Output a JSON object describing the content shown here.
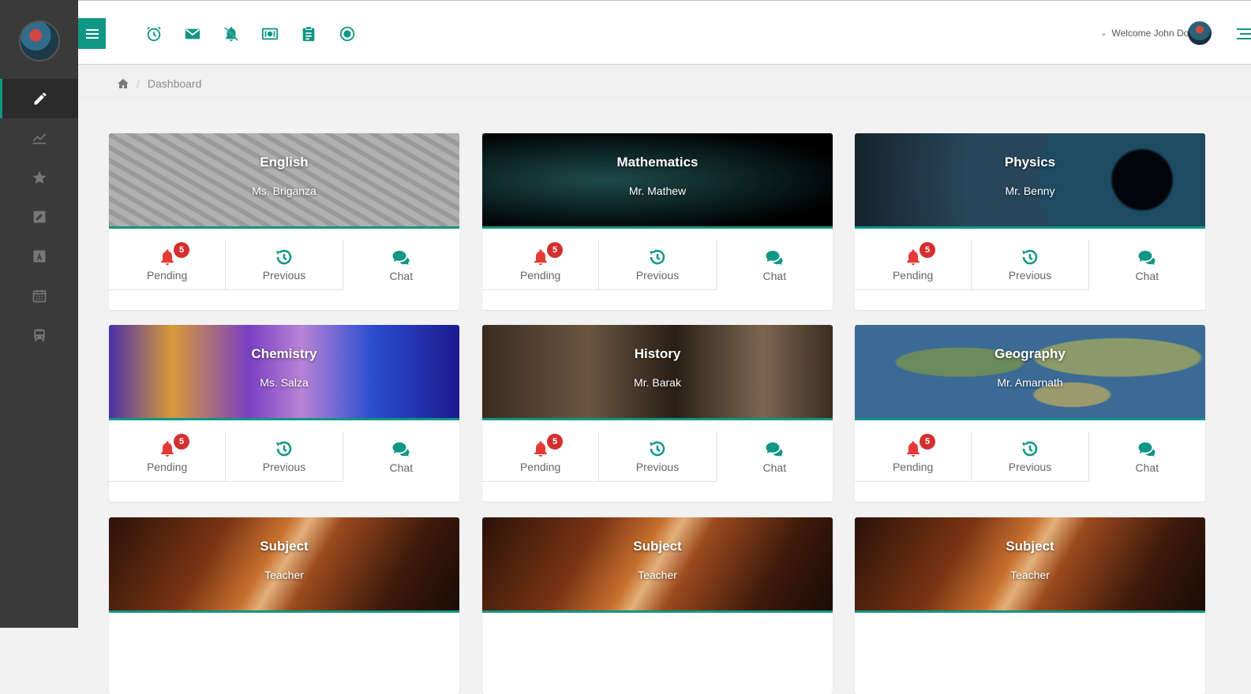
{
  "header": {
    "welcome_text": "Welcome John Doe"
  },
  "breadcrumb": {
    "home_icon": "home-icon",
    "current": "Dashboard"
  },
  "sidebar": {
    "items": [
      {
        "icon": "pencil-icon",
        "active": true
      },
      {
        "icon": "chart-line-icon",
        "active": false
      },
      {
        "icon": "star-icon",
        "active": false
      },
      {
        "icon": "edit-icon",
        "active": false
      },
      {
        "icon": "font-icon",
        "active": false
      },
      {
        "icon": "calendar-icon",
        "active": false
      },
      {
        "icon": "bus-icon",
        "active": false
      }
    ]
  },
  "topbar_icons": [
    "alarm-clock-icon",
    "envelope-icon",
    "bell-off-icon",
    "money-icon",
    "clipboard-icon",
    "record-icon"
  ],
  "actions": {
    "pending": "Pending",
    "previous": "Previous",
    "chat": "Chat",
    "badge": "5"
  },
  "cards": [
    {
      "subject": "English",
      "teacher": "Ms. Briganza"
    },
    {
      "subject": "Mathematics",
      "teacher": "Mr. Mathew"
    },
    {
      "subject": "Physics",
      "teacher": "Mr. Benny"
    },
    {
      "subject": "Chemistry",
      "teacher": "Ms. Salza"
    },
    {
      "subject": "History",
      "teacher": "Mr. Barak"
    },
    {
      "subject": "Geography",
      "teacher": "Mr. Amarnath"
    },
    {
      "subject": "Subject",
      "teacher": "Teacher"
    },
    {
      "subject": "Subject",
      "teacher": "Teacher"
    },
    {
      "subject": "Subject",
      "teacher": "Teacher"
    }
  ],
  "colors": {
    "accent": "#109684",
    "sidebar": "#3a3a3a",
    "badge": "#d32f2f",
    "bell": "#e53935"
  }
}
